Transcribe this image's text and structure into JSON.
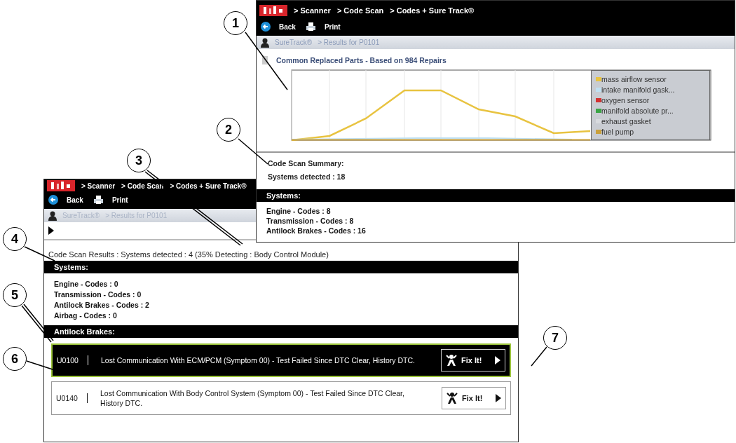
{
  "suretrack_window": {
    "breadcrumbs": [
      "> Scanner",
      "> Code Scan",
      "> Codes + Sure Track®"
    ],
    "toolbar": [
      {
        "kind": "back",
        "label": "Back"
      },
      {
        "kind": "print",
        "label": "Print"
      }
    ],
    "path": [
      "SureTrack®",
      "> Results for P0101"
    ],
    "chart": {
      "title": "Common Replaced Parts - Based on 984 Repairs",
      "legend": [
        {
          "label": "mass airflow sensor",
          "color": "#e8c340"
        },
        {
          "label": "intake manifold gask...",
          "color": "#bfe0f2"
        },
        {
          "label": "oxygen sensor",
          "color": "#d43030"
        },
        {
          "label": "manifold absolute pr...",
          "color": "#3aa545"
        },
        {
          "label": "exhaust gasket",
          "color": "#d8dade"
        },
        {
          "label": "fuel pump",
          "color": "#c9a03c"
        }
      ]
    },
    "summary": {
      "title": "Code Scan Summary:",
      "detected": "Systems detected : 18"
    },
    "systems": {
      "heading": "Systems:",
      "items": [
        "Engine - Codes : 8",
        "Transmission - Codes : 8",
        "Antilock Brakes - Codes : 16"
      ]
    }
  },
  "code_scan_window": {
    "breadcrumbs": [
      "> Scanner",
      "> Code Scan",
      "> Codes + Sure Track®"
    ],
    "toolbar": [
      {
        "kind": "back",
        "label": "Back"
      },
      {
        "kind": "print",
        "label": "Print"
      }
    ],
    "path": [
      "SureTrack®",
      "> Results for P0101"
    ],
    "status": "Code Scan Results : Systems detected : 4  (35% Detecting : Body Control Module)",
    "systems": {
      "heading": "Systems:",
      "items": [
        "Engine - Codes : 0",
        "Transmission - Codes : 0",
        "Antilock Brakes - Codes : 2",
        "Airbag - Codes : 0"
      ]
    },
    "section": {
      "heading": "Antilock Brakes:",
      "faults": [
        {
          "code": "U0100",
          "description": "Lost Communication With ECM/PCM (Symptom 00) - Test Failed Since DTC Clear, History DTC.",
          "button": "Fix It!",
          "selected": true
        },
        {
          "code": "U0140",
          "description": "Lost Communication With Body Control System (Symptom 00) - Test Failed Since DTC Clear, History DTC.",
          "button": "Fix It!",
          "selected": false
        }
      ]
    }
  },
  "callouts": [
    {
      "label": "1"
    },
    {
      "label": "2"
    },
    {
      "label": "3"
    },
    {
      "label": "4"
    },
    {
      "label": "5"
    },
    {
      "label": "6"
    },
    {
      "label": "7"
    }
  ]
}
